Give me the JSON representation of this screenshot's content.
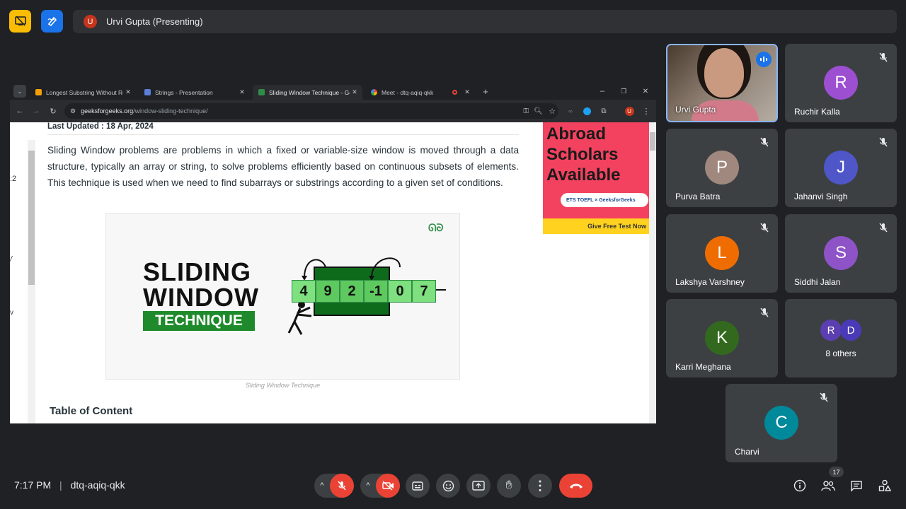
{
  "top": {
    "presenter_initial": "U",
    "presenter_label": "Urvi Gupta (Presenting)"
  },
  "browser": {
    "tabs": [
      {
        "label": "Longest Substring Without Rep",
        "close": "✕"
      },
      {
        "label": "Strings - Presentation",
        "close": "✕"
      },
      {
        "label": "Sliding Window Technique - Ge",
        "close": "✕"
      },
      {
        "label": "Meet - dtq-aqiq-qkk",
        "close": "✕"
      }
    ],
    "url_domain": "geeksforgeeks.org",
    "url_path": "/window-sliding-technique/",
    "profile_initial": "U"
  },
  "article": {
    "updated": "Last Updated : 18 Apr, 2024",
    "body": "Sliding Window problems are problems in which a fixed or variable-size window is moved through a data structure, typically an array or string, to solve problems efficiently based on continuous subsets of elements. This technique is used when we need to find subarrays or substrings according to a given set of conditions.",
    "figure_title_1": "SLIDING",
    "figure_title_2": "WINDOW",
    "figure_title_3": "TECHNIQUE",
    "figure_values": [
      "4",
      "9",
      "2",
      "-1",
      "0",
      "7"
    ],
    "caption": "Sliding Window Technique",
    "toc": "Table of Content",
    "gutter_marks": [
      ":2",
      "/",
      "v"
    ]
  },
  "ad": {
    "line1": "Abroad",
    "line2": "Scholars",
    "line3": "Available",
    "pill": "ETS TOEFL × GeeksforGeeks",
    "cta": "Give Free Test Now"
  },
  "participants": [
    {
      "name": "Urvi Gupta",
      "initial": "",
      "color": "#8a6a55",
      "muted": false
    },
    {
      "name": "Ruchir Kalla",
      "initial": "R",
      "color": "#9c4fd1",
      "muted": true
    },
    {
      "name": "Purva Batra",
      "initial": "P",
      "color": "#a1887f",
      "muted": true
    },
    {
      "name": "Jahanvi Singh",
      "initial": "J",
      "color": "#4e56c8",
      "muted": true
    },
    {
      "name": "Lakshya Varshney",
      "initial": "L",
      "color": "#ef6c00",
      "muted": true
    },
    {
      "name": "Siddhi Jalan",
      "initial": "S",
      "color": "#8e53c7",
      "muted": true
    },
    {
      "name": "Karri Meghana",
      "initial": "K",
      "color": "#33691e",
      "muted": true
    },
    {
      "name": "Charvi",
      "initial": "C",
      "color": "#00899a",
      "muted": true
    }
  ],
  "others": {
    "label": "8 others",
    "initials": [
      "R",
      "D"
    ],
    "colors": [
      "#5b3fb0",
      "#4a3ab8"
    ]
  },
  "bottom": {
    "time": "7:17 PM",
    "meeting_code": "dtq-aqiq-qkk",
    "people_count": "17"
  },
  "colors": {
    "accent": "#8ab4f8",
    "danger": "#ea4335",
    "background": "#202124",
    "tile": "#3c4043"
  }
}
